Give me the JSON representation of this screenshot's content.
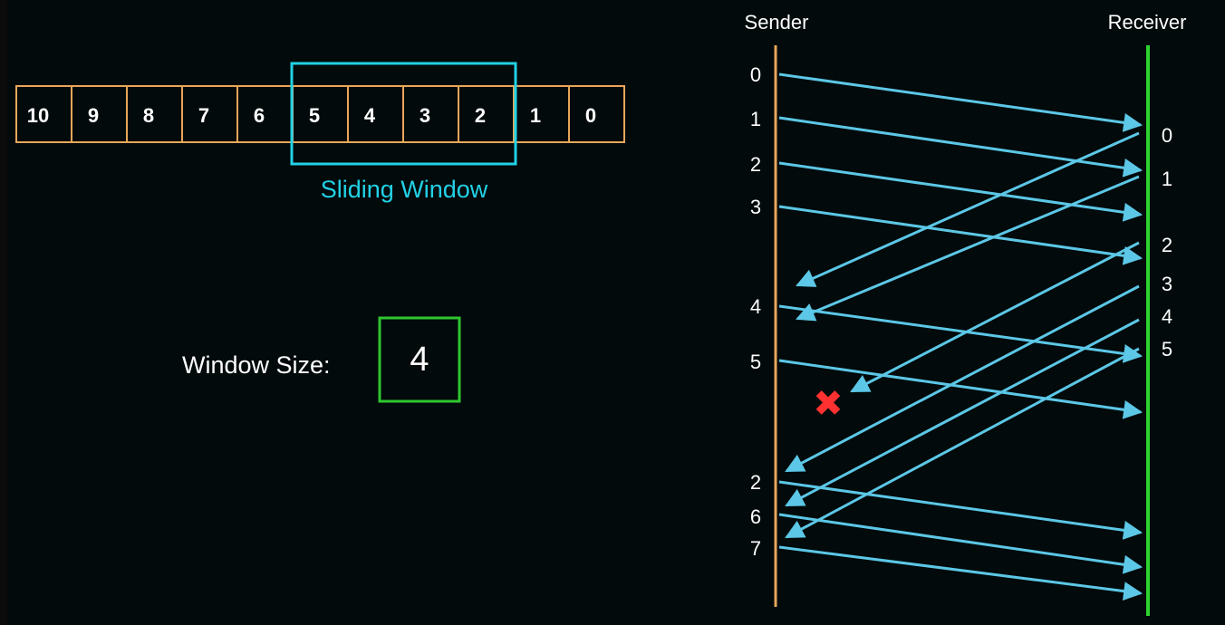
{
  "colors": {
    "background": "#020a0b",
    "sequence_box": "#e7a65a",
    "window": "#22d1e6",
    "window_size_box": "#2fc52f",
    "sender_line": "#e7a65a",
    "receiver_line": "#2fd32f",
    "arrow": "#5cc7e6",
    "lost_marker": "#ff3131",
    "text": "#ffffff"
  },
  "sequence": {
    "numbers": [
      "10",
      "9",
      "8",
      "7",
      "6",
      "5",
      "4",
      "3",
      "2",
      "1",
      "0"
    ],
    "window_label": "Sliding Window"
  },
  "window_size": {
    "label": "Window Size:",
    "value": "4"
  },
  "timeline": {
    "sender_label": "Sender",
    "receiver_label": "Receiver",
    "sender_marks": [
      "0",
      "1",
      "2",
      "3",
      "4",
      "5",
      "2",
      "6",
      "7"
    ],
    "receiver_marks": [
      "0",
      "1",
      "2",
      "3",
      "4",
      "5"
    ],
    "lost_marker": "✖",
    "arrows": [
      {
        "name": "frame-0-arrow",
        "kind": "frame",
        "label": "0"
      },
      {
        "name": "frame-1-arrow",
        "kind": "frame",
        "label": "1"
      },
      {
        "name": "frame-2-arrow",
        "kind": "frame",
        "label": "2"
      },
      {
        "name": "frame-3-arrow",
        "kind": "frame",
        "label": "3"
      },
      {
        "name": "ack-0-arrow",
        "kind": "ack",
        "label": "0"
      },
      {
        "name": "ack-1-arrow",
        "kind": "ack",
        "label": "1"
      },
      {
        "name": "ack-2-lost-arrow",
        "kind": "ack",
        "label": "2"
      },
      {
        "name": "frame-4-arrow",
        "kind": "frame",
        "label": "4"
      },
      {
        "name": "frame-5-arrow",
        "kind": "frame",
        "label": "5"
      },
      {
        "name": "ack-3-arrow",
        "kind": "ack",
        "label": "3"
      },
      {
        "name": "ack-4-arrow",
        "kind": "ack",
        "label": "4"
      },
      {
        "name": "ack-5-arrow",
        "kind": "ack",
        "label": "5"
      },
      {
        "name": "frame-2-resend-arrow",
        "kind": "frame",
        "label": "2"
      },
      {
        "name": "frame-6-arrow",
        "kind": "frame",
        "label": "6"
      },
      {
        "name": "frame-7-arrow",
        "kind": "frame",
        "label": "7"
      }
    ]
  }
}
